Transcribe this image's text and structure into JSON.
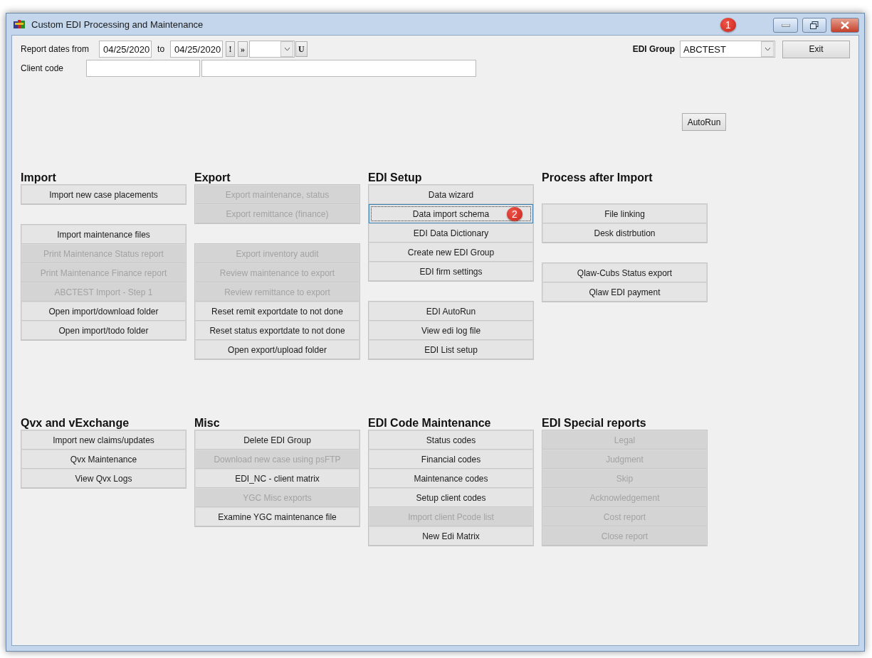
{
  "window": {
    "title": "Custom EDI Processing and Maintenance"
  },
  "filters": {
    "dates_label": "Report dates from",
    "date_from": "04/25/2020",
    "to_label": "to",
    "date_to": "04/25/2020",
    "bang_button": "!",
    "forward_button": "»",
    "u_button": "U",
    "client_label": "Client code"
  },
  "edi_group": {
    "label": "EDI Group",
    "value": "ABCTEST",
    "callout": "1"
  },
  "exit_button": "Exit",
  "autorun_button": "AutoRun",
  "sections": [
    {
      "title": "Import",
      "blocks": [
        [
          {
            "label": "Import new case placements",
            "disabled": false,
            "focused": false
          }
        ],
        [
          {
            "label": "Import maintenance files",
            "disabled": false,
            "focused": false
          },
          {
            "label": "Print Maintenance Status report",
            "disabled": true,
            "focused": false
          },
          {
            "label": "Print Maintenance Finance report",
            "disabled": true,
            "focused": false
          },
          {
            "label": "ABCTEST Import - Step 1",
            "disabled": true,
            "focused": false
          },
          {
            "label": "Open import/download folder",
            "disabled": false,
            "focused": false
          },
          {
            "label": "Open import/todo folder",
            "disabled": false,
            "focused": false
          }
        ]
      ]
    },
    {
      "title": "Export",
      "blocks": [
        [
          {
            "label": "Export maintenance, status",
            "disabled": true,
            "focused": false
          },
          {
            "label": "Export remittance (finance)",
            "disabled": true,
            "focused": false
          }
        ],
        [
          {
            "label": "Export inventory audit",
            "disabled": true,
            "focused": false
          },
          {
            "label": "Review maintenance to export",
            "disabled": true,
            "focused": false
          },
          {
            "label": "Review remittance to export",
            "disabled": true,
            "focused": false
          },
          {
            "label": "Reset remit exportdate to not done",
            "disabled": false,
            "focused": false
          },
          {
            "label": "Reset status exportdate to not done",
            "disabled": false,
            "focused": false
          },
          {
            "label": "Open export/upload folder",
            "disabled": false,
            "focused": false
          }
        ]
      ]
    },
    {
      "title": "EDI Setup",
      "blocks": [
        [
          {
            "label": "Data wizard",
            "disabled": false,
            "focused": false
          },
          {
            "label": "Data import schema",
            "disabled": false,
            "focused": true,
            "callout": "2"
          },
          {
            "label": "EDI Data Dictionary",
            "disabled": false,
            "focused": false
          },
          {
            "label": "Create new EDI Group",
            "disabled": false,
            "focused": false
          },
          {
            "label": "EDI firm settings",
            "disabled": false,
            "focused": false
          }
        ],
        [
          {
            "label": "EDI AutoRun",
            "disabled": false,
            "focused": false
          },
          {
            "label": "View edi log file",
            "disabled": false,
            "focused": false
          },
          {
            "label": "EDI List setup",
            "disabled": false,
            "focused": false
          }
        ]
      ]
    },
    {
      "title": "Process after Import",
      "blocks": [
        [
          {
            "label": "File linking",
            "disabled": false,
            "focused": false
          },
          {
            "label": "Desk distrbution",
            "disabled": false,
            "focused": false
          }
        ],
        [
          {
            "label": "Qlaw-Cubs Status export",
            "disabled": false,
            "focused": false
          },
          {
            "label": "Qlaw EDI payment",
            "disabled": false,
            "focused": false
          }
        ]
      ]
    },
    {
      "title": "Qvx and vExchange",
      "blocks": [
        [
          {
            "label": "Import new claims/updates",
            "disabled": false,
            "focused": false
          },
          {
            "label": "Qvx Maintenance",
            "disabled": false,
            "focused": false
          },
          {
            "label": "View Qvx Logs",
            "disabled": false,
            "focused": false
          }
        ]
      ]
    },
    {
      "title": "Misc",
      "blocks": [
        [
          {
            "label": "Delete EDI Group",
            "disabled": false,
            "focused": false
          },
          {
            "label": "Download new case using psFTP",
            "disabled": true,
            "focused": false
          },
          {
            "label": "EDI_NC - client matrix",
            "disabled": false,
            "focused": false
          },
          {
            "label": "YGC Misc exports",
            "disabled": true,
            "focused": false
          },
          {
            "label": "Examine YGC maintenance file",
            "disabled": false,
            "focused": false
          }
        ]
      ]
    },
    {
      "title": "EDI Code Maintenance",
      "blocks": [
        [
          {
            "label": "Status codes",
            "disabled": false,
            "focused": false
          },
          {
            "label": "Financial codes",
            "disabled": false,
            "focused": false
          },
          {
            "label": "Maintenance codes",
            "disabled": false,
            "focused": false
          },
          {
            "label": "Setup client codes",
            "disabled": false,
            "focused": false
          },
          {
            "label": "Import client Pcode list",
            "disabled": true,
            "focused": false
          },
          {
            "label": "New Edi Matrix",
            "disabled": false,
            "focused": false
          }
        ]
      ]
    },
    {
      "title": "EDI Special reports",
      "blocks": [
        [
          {
            "label": "Legal",
            "disabled": true,
            "focused": false
          },
          {
            "label": "Judgment",
            "disabled": true,
            "focused": false
          },
          {
            "label": "Skip",
            "disabled": true,
            "focused": false
          },
          {
            "label": "Acknowledgement",
            "disabled": true,
            "focused": false
          },
          {
            "label": "Cost report",
            "disabled": true,
            "focused": false
          },
          {
            "label": "Close report",
            "disabled": true,
            "focused": false
          }
        ]
      ]
    }
  ]
}
